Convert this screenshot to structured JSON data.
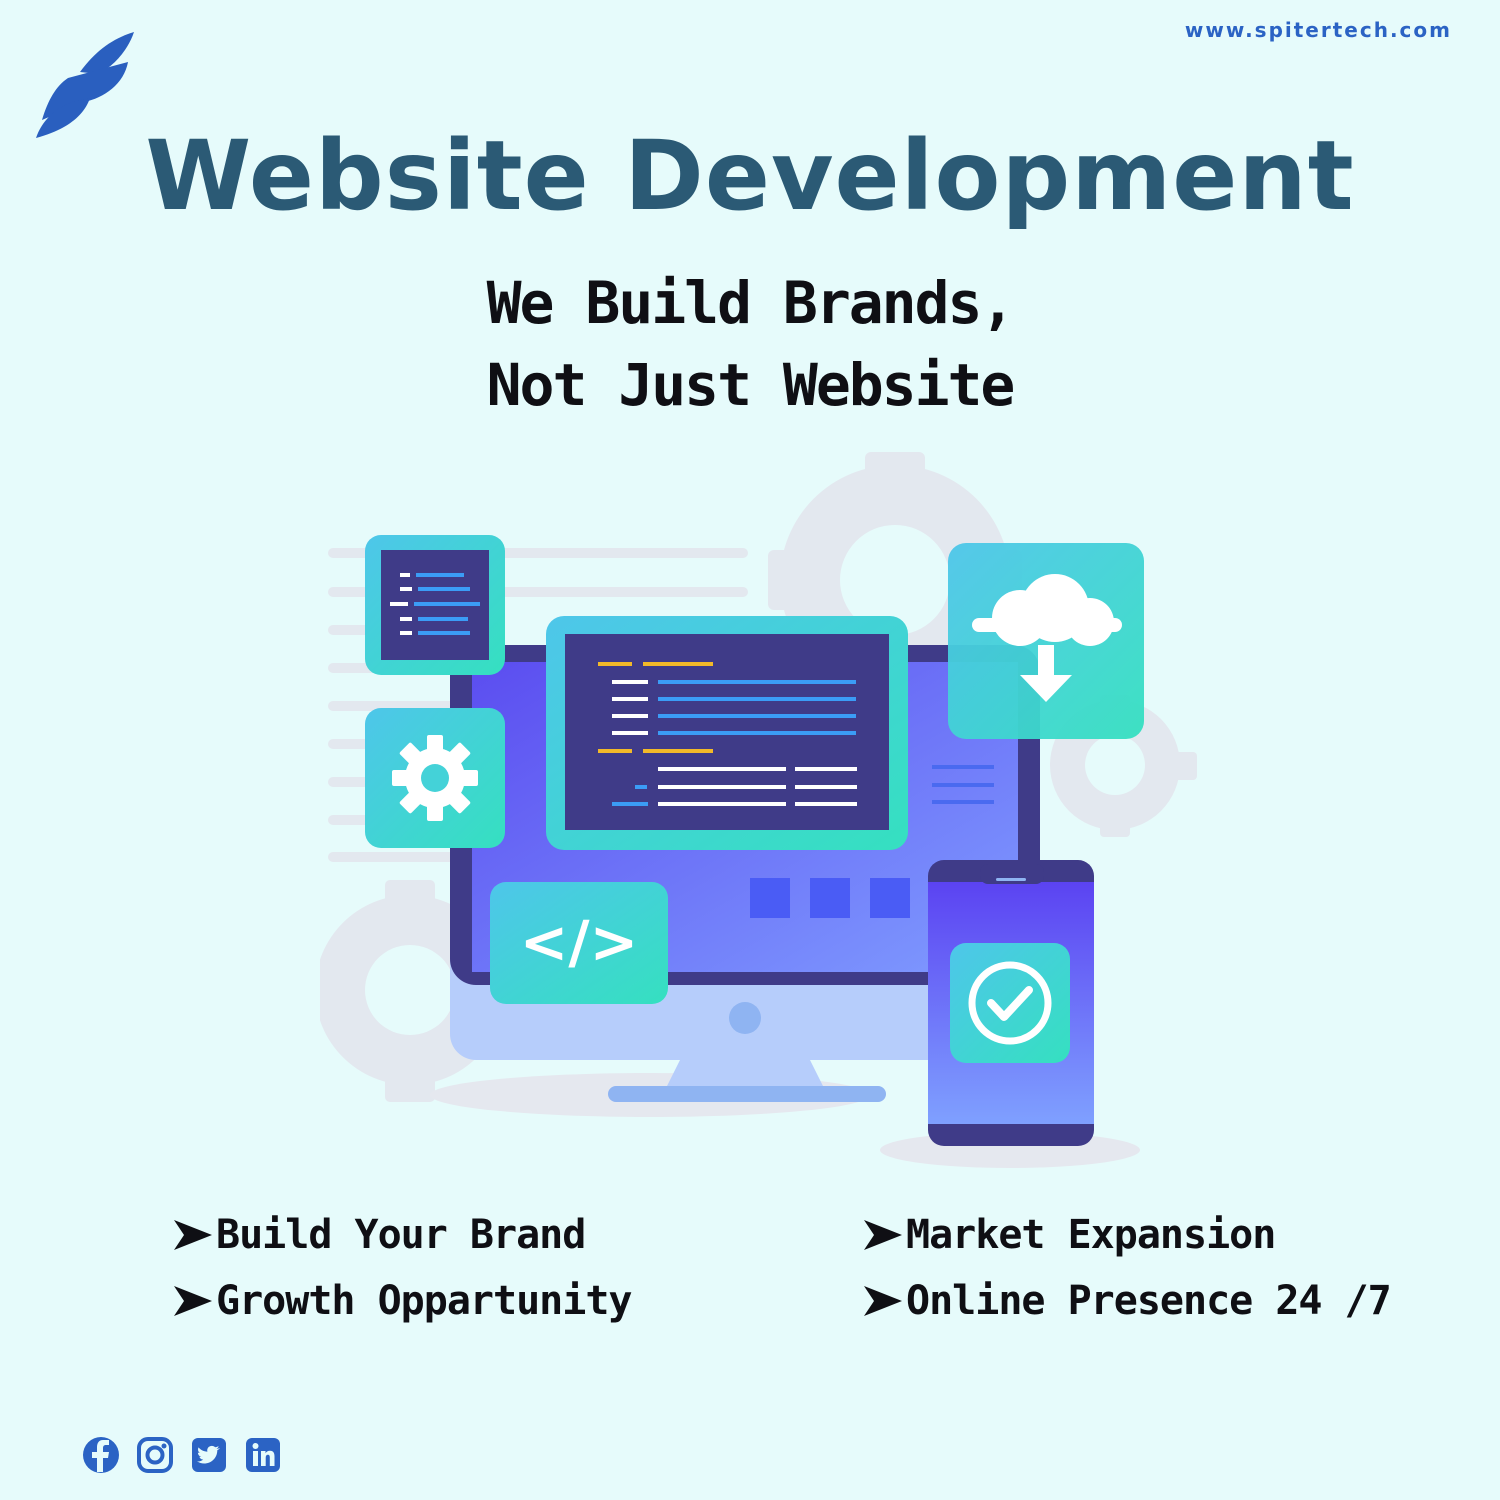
{
  "header": {
    "url": "www.spitertech.com",
    "title": "Website Development",
    "tagline_line1": "We Build Brands,",
    "tagline_line2": "Not Just Website"
  },
  "features": [
    {
      "label": "Build Your Brand"
    },
    {
      "label": "Market Expansion"
    },
    {
      "label": "Growth Oppartunity"
    },
    {
      "label": "Online Presence 24 /7"
    }
  ],
  "social": [
    "facebook-icon",
    "instagram-icon",
    "twitter-icon",
    "linkedin-icon"
  ],
  "colors": {
    "background": "#e6fbfb",
    "title": "#2b5a75",
    "brand_blue": "#2b63c4",
    "text": "#0f0f14",
    "teal": "#3dd9c9",
    "purple": "#5a55e8"
  }
}
